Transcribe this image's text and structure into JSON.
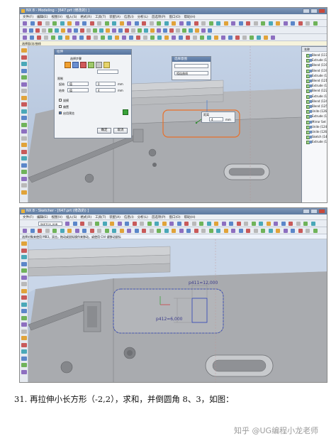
{
  "screenshot1": {
    "window_title": "NX 8 - Modeling - [647.prt (修改的) ]",
    "menu": [
      "文件(F)",
      "编辑(E)",
      "视图(V)",
      "插入(S)",
      "格式(R)",
      "工具(T)",
      "装配(A)",
      "信息(I)",
      "分析(L)",
      "首选项(P)",
      "窗口(O)",
      "帮助(H)"
    ],
    "cue_text": "选择面/边/曲线",
    "extrude_dialog": {
      "title": "拉伸",
      "section_header": "选择步骤",
      "limits_label": "限制",
      "start_label": "起始",
      "start_value": "值",
      "start_dist": "0",
      "end_label": "结束",
      "end_value": "值",
      "end_dist": "4",
      "unit": "mm",
      "option_draft": "拔模",
      "option_offset": "偏置",
      "option_preview": "启用预览",
      "ok_label": "确定",
      "cancel_label": "取消"
    },
    "filter_panel": {
      "title": "选择意图",
      "item1": "",
      "item2": "相连曲线"
    },
    "distance_popup": {
      "label": "距离",
      "value": "4",
      "unit": "mm"
    },
    "part_navigator": {
      "header": "名称",
      "items": [
        "Blend (117 ...",
        "Extrude (1...",
        "Blend (119)",
        "Blend (119)",
        "Extrude (12...",
        "Blend (121)",
        "Extrude (12...",
        "Blend (122...",
        "Extrude (12...",
        "Blend (124)",
        "Blend (125)",
        "Unite (126)",
        "Extrude (12...",
        "Mirror Set",
        "Unite (124)",
        "Unite (126)",
        "Sketch (14...",
        "Extrude (1..."
      ]
    }
  },
  "screenshot2": {
    "window_title": "NX 8 - Sketcher - [647.prt (修改的) ]",
    "menu": [
      "文件(F)",
      "编辑(E)",
      "视图(V)",
      "插入(S)",
      "格式(R)",
      "工具(T)",
      "装配(A)",
      "信息(I)",
      "分析(L)",
      "首选项(P)",
      "窗口(O)",
      "帮助(H)"
    ],
    "sketch_name": "SKETCH_008",
    "cue_text": "选择对象来使用 MB3，双击，拖动或鼠标操作来移动，或使用 Ctrl 键移动鼠标",
    "dimension_horizontal": "p411=12,000",
    "dimension_vertical": "p412=6,000"
  },
  "caption": "31. 再拉伸小长方形（-2,2），求和，并倒圆角 8、3，如图：",
  "watermark": "知乎 @UG编程小龙老师",
  "colors": {
    "title_bar": "#5d7aa0",
    "viewport_bg": "#b8c8de",
    "part_gray": "#a7a9ad",
    "highlight_orange": "#e8702a",
    "sketch_blue": "#2a3fb8",
    "dimension_gray": "#8a8a8a"
  }
}
